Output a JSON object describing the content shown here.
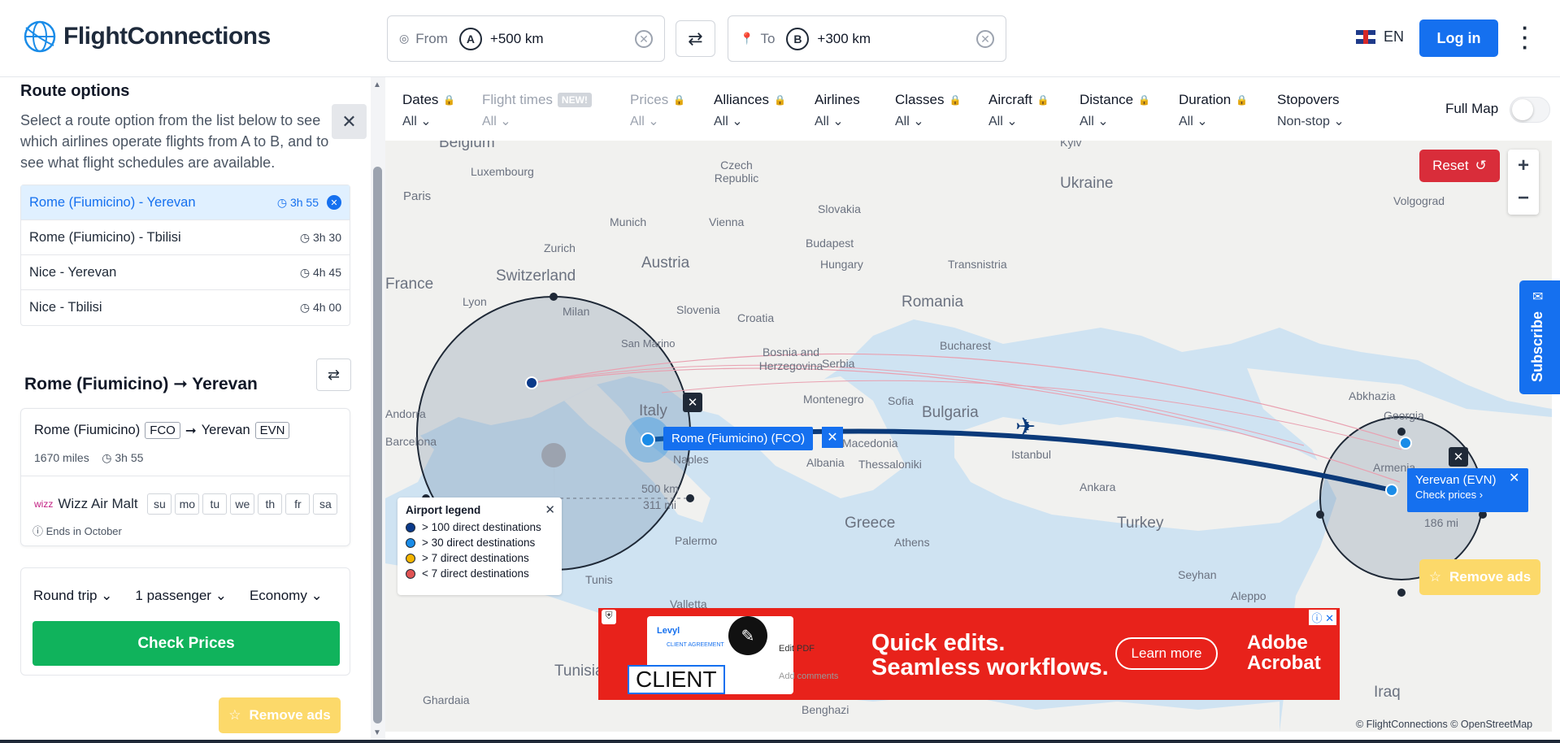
{
  "header": {
    "logo_text": "FlightConnections",
    "from": {
      "label": "From",
      "letter": "A",
      "value": "+500 km"
    },
    "to": {
      "label": "To",
      "letter": "B",
      "value": "+300 km"
    },
    "lang": "EN",
    "login": "Log in"
  },
  "sidebar": {
    "title": "Route options",
    "description": "Select a route option from the list below to see which airlines operate flights from A to B, and to see what flight schedules are available.",
    "routes": [
      {
        "label": "Rome (Fiumicino)  -  Yerevan",
        "time": "3h 55",
        "selected": true
      },
      {
        "label": "Rome (Fiumicino)  -  Tbilisi",
        "time": "3h 30"
      },
      {
        "label": "Nice  -  Yerevan",
        "time": "4h 45"
      },
      {
        "label": "Nice  -  Tbilisi",
        "time": "4h 00"
      }
    ],
    "selected_title_from": "Rome (Fiumicino)",
    "selected_title_to": "Yerevan",
    "flight": {
      "from": "Rome (Fiumicino)",
      "from_code": "FCO",
      "to": "Yerevan",
      "to_code": "EVN",
      "distance": "1670 miles",
      "duration": "3h 55",
      "airline": "Wizz Air Malt",
      "days": [
        "su",
        "mo",
        "tu",
        "we",
        "th",
        "fr",
        "sa"
      ],
      "ends": "Ends in October"
    },
    "booking": {
      "trip": "Round trip",
      "passengers": "1 passenger",
      "class": "Economy",
      "cta": "Check Prices"
    },
    "remove_ads": "Remove ads"
  },
  "filters": [
    {
      "name": "Dates",
      "value": "All",
      "locked": true
    },
    {
      "name": "Flight times",
      "value": "All",
      "badge": "NEW!",
      "disabled": true
    },
    {
      "name": "Prices",
      "value": "All",
      "locked": true,
      "disabled": true
    },
    {
      "name": "Alliances",
      "value": "All",
      "locked": true
    },
    {
      "name": "Airlines",
      "value": "All"
    },
    {
      "name": "Classes",
      "value": "All",
      "locked": true
    },
    {
      "name": "Aircraft",
      "value": "All",
      "locked": true
    },
    {
      "name": "Distance",
      "value": "All",
      "locked": true
    },
    {
      "name": "Duration",
      "value": "All",
      "locked": true
    },
    {
      "name": "Stopovers",
      "value": "Non-stop"
    }
  ],
  "full_map": "Full Map",
  "map": {
    "reset": "Reset",
    "subscribe": "Subscribe",
    "fco_tip": "Rome (Fiumicino) (FCO)",
    "evn_tip": "Yerevan (EVN)",
    "evn_check": "Check prices",
    "radius_a_km": "500 km",
    "radius_a_mi": "311 mi",
    "radius_b_mi": "186 mi",
    "remove_ads": "Remove ads",
    "copyright": "© FlightConnections © OpenStreetMap",
    "labels": [
      "Belgium",
      "Luxembourg",
      "Paris",
      "Czech Republic",
      "Ukraine",
      "Munich",
      "Vienna",
      "Slovakia",
      "Volgograd",
      "Zurich",
      "Austria",
      "Budapest",
      "Hungary",
      "Switzerland",
      "France",
      "Transnistria",
      "Lyon",
      "Milan",
      "Slovenia",
      "Croatia",
      "Romania",
      "Bucharest",
      "Bosnia and Herzegovina",
      "Serbia",
      "San Marino",
      "Montenegro",
      "Sofia",
      "Bulgaria",
      "Abkhazia",
      "Italy",
      "Georgia",
      "Barcelona",
      "Naples",
      "Macedonia",
      "Albania",
      "Thessaloniki",
      "Istanbul",
      "Ankara",
      "Turkey",
      "Armenia",
      "Palermo",
      "Greece",
      "Athens",
      "Tunis",
      "Valletta",
      "Tunisia",
      "Seyhan",
      "Aleppo",
      "Iraq",
      "Ghardaia",
      "Benghazi",
      "Andorra",
      "Kyiv"
    ],
    "legend": {
      "title": "Airport legend",
      "rows": [
        {
          "label": "> 100 direct destinations",
          "color": "#0b3a8a"
        },
        {
          "label": "> 30 direct destinations",
          "color": "#1a8ce8"
        },
        {
          "label": "> 7 direct destinations",
          "color": "#f4b400"
        },
        {
          "label": "< 7 direct destinations",
          "color": "#e05353"
        }
      ]
    }
  },
  "ad": {
    "headline1": "Quick edits.",
    "headline2": "Seamless workflows.",
    "button": "Learn more",
    "brand1": "Adobe",
    "brand2": "Acrobat",
    "doc_client": "CLIENT",
    "doc_edit": "Edit PDF",
    "doc_comments": "Add comments",
    "doc_brand": "Levyl",
    "doc_agreement": "CLIENT AGREEMENT"
  }
}
